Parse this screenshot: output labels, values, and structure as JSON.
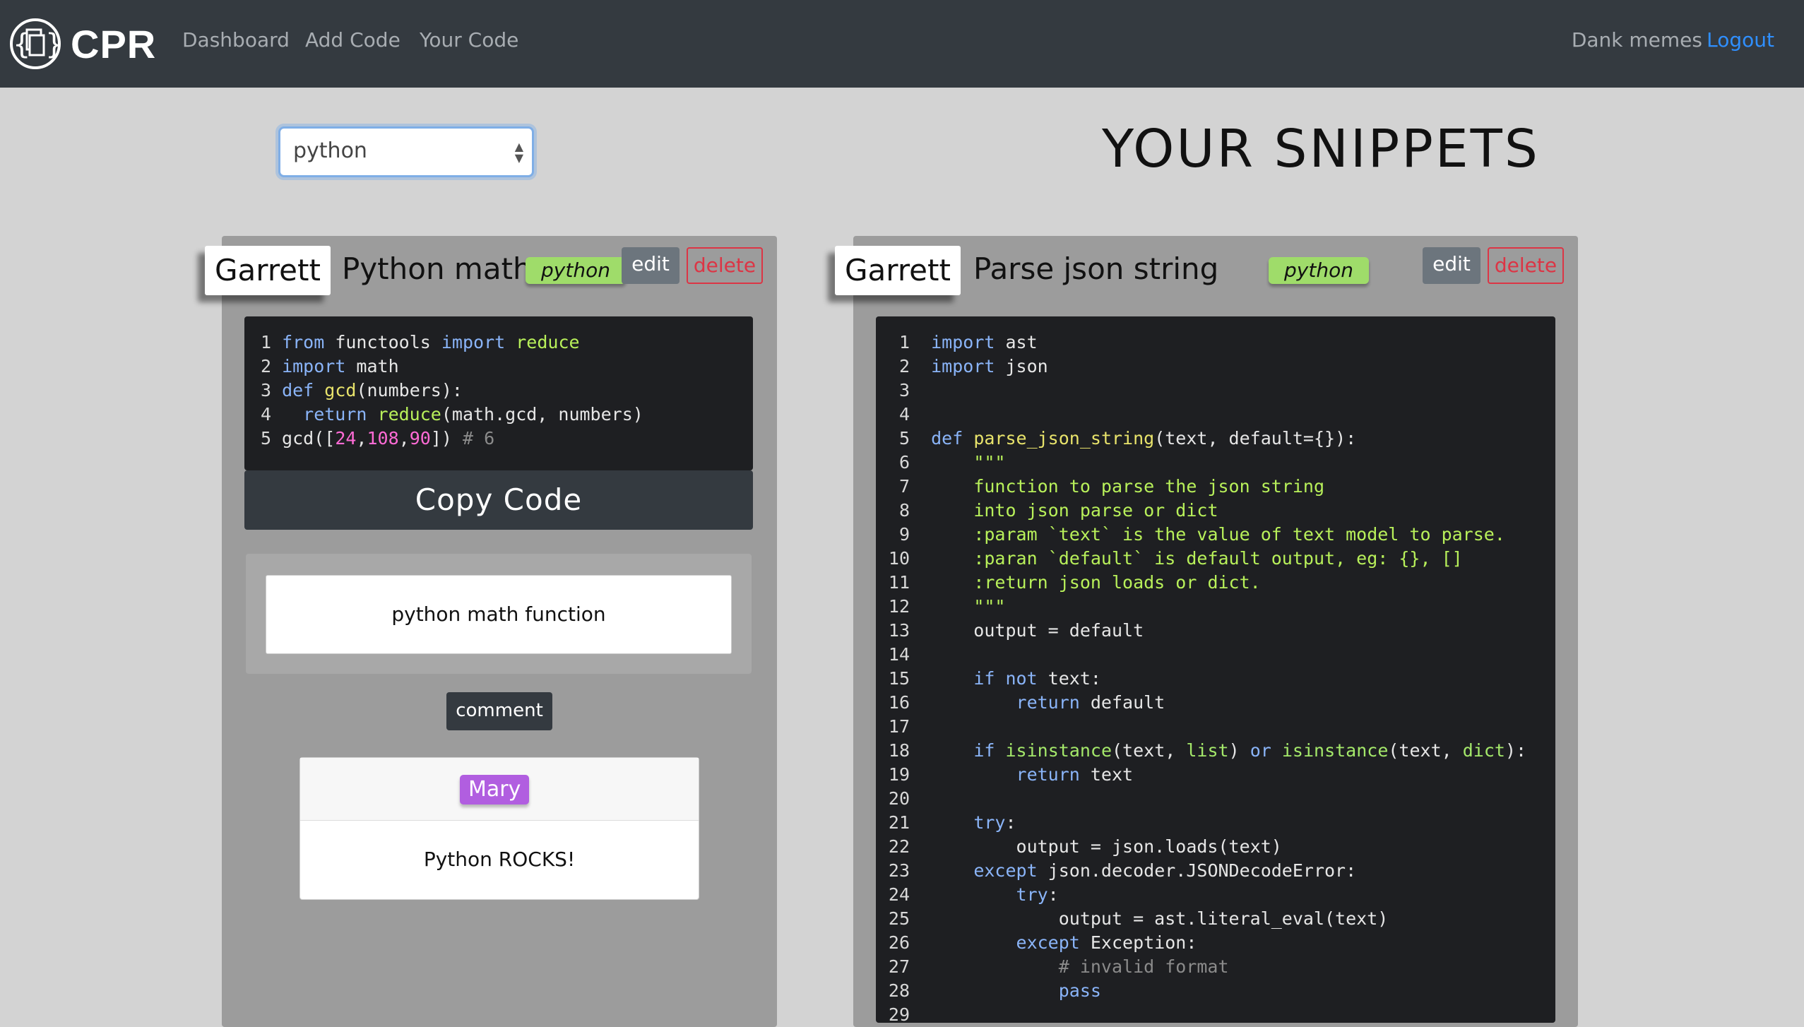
{
  "navbar": {
    "brand": "CPR",
    "links": [
      "Dashboard",
      "Add Code",
      "Your Code"
    ],
    "user": "Dank memes",
    "logout": "Logout"
  },
  "filter": {
    "language_selected": "python"
  },
  "page_title": "YOUR SNIPPETS",
  "snippets": [
    {
      "author": "Garrett",
      "title": "Python math",
      "language": "python",
      "edit_label": "edit",
      "delete_label": "delete",
      "code_lines": [
        "from functools import reduce",
        "import math",
        "def gcd(numbers):",
        "  return reduce(math.gcd, numbers)",
        "gcd([24,108,90]) # 6"
      ],
      "copy_label": "Copy Code",
      "description": "python math function",
      "comment_button": "comment",
      "comments": [
        {
          "author": "Mary",
          "text": "Python ROCKS!"
        }
      ]
    },
    {
      "author": "Garrett",
      "title": "Parse json string",
      "language": "python",
      "edit_label": "edit",
      "delete_label": "delete",
      "code_lines": [
        "import ast",
        "import json",
        "",
        "",
        "def parse_json_string(text, default={}):",
        "    \"\"\"",
        "    function to parse the json string",
        "    into json parse or dict",
        "    :param `text` is the value of text model to parse.",
        "    :paran `default` is default output, eg: {}, []",
        "    :return json loads or dict.",
        "    \"\"\"",
        "    output = default",
        "",
        "    if not text:",
        "        return default",
        "",
        "    if isinstance(text, list) or isinstance(text, dict):",
        "        return text",
        "",
        "    try:",
        "        output = json.loads(text)",
        "    except json.decoder.JSONDecodeError:",
        "        try:",
        "            output = ast.literal_eval(text)",
        "        except Exception:",
        "            # invalid format",
        "            pass",
        "29"
      ]
    }
  ]
}
